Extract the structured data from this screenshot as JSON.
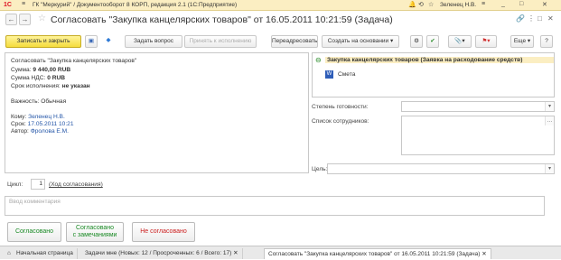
{
  "titlebar": {
    "logo": "1С",
    "title": "ГК \"Меркурий\" / Документооборот 8 КОРП, редакция 2.1 (1С:Предприятие)",
    "user": "Зеленец Н.В."
  },
  "header": {
    "title": "Согласовать \"Закупка канцелярских товаров\" от 16.05.2011 10:21:59 (Задача)"
  },
  "toolbar": {
    "save_close": "Записать и закрыть",
    "ask_question": "Задать вопрос",
    "accept": "Принять к исполнению",
    "redirect": "Переадресовать",
    "create_based": "Создать на основании",
    "more": "Еще",
    "help": "?"
  },
  "task": {
    "title": "Согласовать \"Закупка канцелярских товаров\"",
    "sum_label": "Сумма:",
    "sum_value": "9 440,00 RUB",
    "vat_label": "Сумма НДС:",
    "vat_value": "0 RUB",
    "deadline_label": "Срок исполнения:",
    "deadline_value": "не указан",
    "importance": "Важность: Обычная",
    "to_label": "Кому:",
    "to_value": "Зеленец Н.В.",
    "due_label": "Срок:",
    "due_value": "17.05.2011 10:21",
    "author_label": "Автор:",
    "author_value": "Фролова Е.М."
  },
  "attachments": {
    "root": "Закупка канцелярских товаров (Заявка на расходование средств)",
    "child": "Смета"
  },
  "form": {
    "readiness_label": "Степень готовности:",
    "staff_label": "Список сотрудников:",
    "goal_label": "Цель:"
  },
  "cycle": {
    "label": "Цикл:",
    "value": "1",
    "link": "(Ход согласования)"
  },
  "comment": {
    "placeholder": "Ввод комментария"
  },
  "actions": {
    "approve": "Согласовано",
    "approve_notes_1": "Согласовано",
    "approve_notes_2": "с замечаниями",
    "reject": "Не согласовано"
  },
  "tabs": [
    {
      "label": "Начальная страница"
    },
    {
      "label": "Задачи мне (Новых: 12 / Просроченных: 6 / Всего: 17)"
    },
    {
      "label": "Согласовать \"Закупка канцелярских товаров\" от 16.05.2011 10:21:59 (Задача)"
    }
  ]
}
